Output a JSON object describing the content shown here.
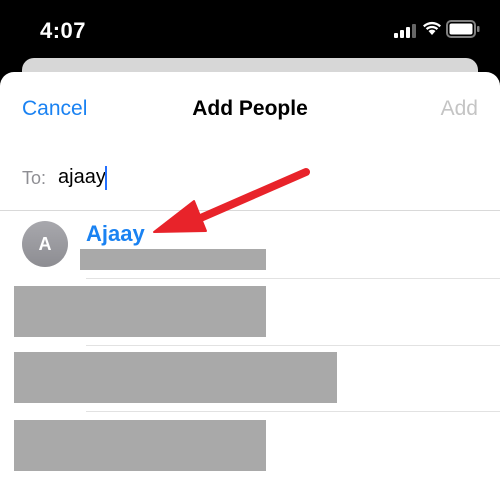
{
  "status_bar": {
    "time": "4:07"
  },
  "sheet": {
    "title": "Add People",
    "cancel_label": "Cancel",
    "add_label": "Add"
  },
  "to_field": {
    "label": "To:",
    "value": "ajaay"
  },
  "contacts": [
    {
      "initial": "A",
      "name": "Ajaay"
    }
  ],
  "colors": {
    "accent": "#1a82f2",
    "annotation_arrow": "#e8232a",
    "disabled": "#c4c4c4"
  }
}
